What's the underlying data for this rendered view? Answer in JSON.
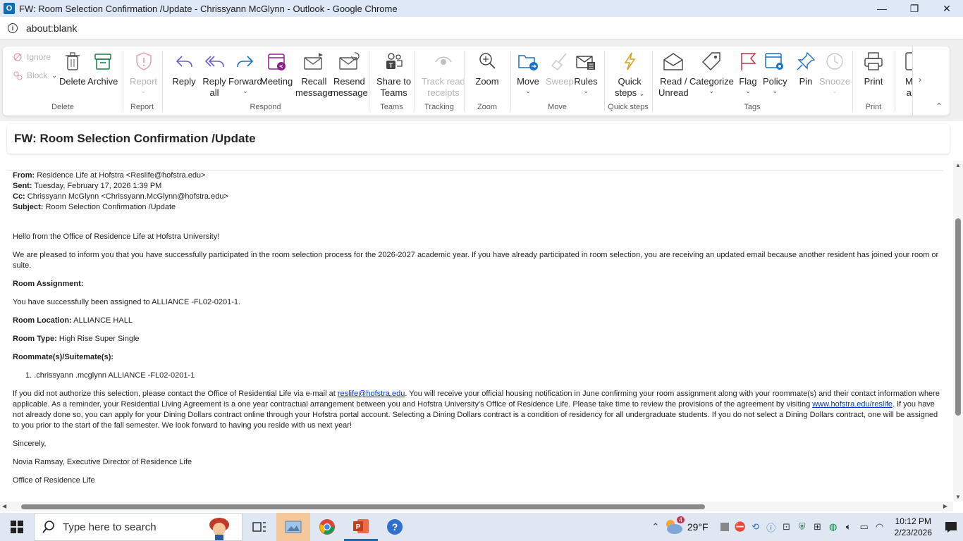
{
  "window": {
    "title": "FW: Room Selection Confirmation /Update - Chrissyann McGlynn - Outlook - Google Chrome",
    "app_icon_letter": "O",
    "url": "about:blank",
    "controls": {
      "minimize": "—",
      "restore": "❐",
      "close": "✕"
    }
  },
  "ribbon": {
    "delete_group": {
      "label": "Delete",
      "ignore": "Ignore",
      "block": "Block",
      "delete": "Delete",
      "archive": "Archive"
    },
    "report_group": {
      "label": "Report",
      "report": "Report"
    },
    "respond_group": {
      "label": "Respond",
      "reply": "Reply",
      "reply_all_1": "Reply",
      "reply_all_2": "all",
      "forward": "Forward",
      "meeting": "Meeting",
      "recall_1": "Recall",
      "recall_2": "message",
      "resend_1": "Resend",
      "resend_2": "message"
    },
    "teams_group": {
      "label": "Teams",
      "share_1": "Share to",
      "share_2": "Teams"
    },
    "tracking_group": {
      "label": "Tracking",
      "track_1": "Track read",
      "track_2": "receipts"
    },
    "zoom_group": {
      "label": "Zoom",
      "zoom": "Zoom"
    },
    "move_group": {
      "label": "Move",
      "move": "Move",
      "sweep": "Sweep",
      "rules": "Rules"
    },
    "quicksteps_group": {
      "label": "Quick steps",
      "quick_1": "Quick",
      "quick_2": "steps"
    },
    "tags_group": {
      "label": "Tags",
      "read_1": "Read /",
      "read_2": "Unread",
      "categorize": "Categorize",
      "flag": "Flag",
      "policy": "Policy",
      "pin": "Pin",
      "snooze": "Snooze"
    },
    "print_group": {
      "label": "Print",
      "print": "Print"
    },
    "more_1": "Mo",
    "more_2": "ap"
  },
  "subject": "FW: Room Selection Confirmation /Update",
  "email": {
    "from_label": "From:",
    "from": "Residence Life at Hofstra <Reslife@hofstra.edu>",
    "sent_label": "Sent:",
    "sent": "Tuesday, February 17, 2026 1:39 PM",
    "cc_label": "Cc:",
    "cc": "Chrissyann McGlynn <Chrissyann.McGlynn@hofstra.edu>",
    "subject_label": "Subject:",
    "subject": "Room Selection Confirmation /Update",
    "greeting": "Hello from the Office of Residence Life at Hofstra University!",
    "intro": "We are pleased to inform you that you have successfully participated in the room selection process for the 2026-2027 academic year. If you have already participated in room selection, you are receiving an updated email because another resident has joined your room or suite.",
    "assignment_heading": "Room Assignment:",
    "assignment_text": "You have successfully been assigned to ALLIANCE -FL02-0201-1.",
    "location_label": "Room Location:",
    "location": "ALLIANCE HALL",
    "type_label": "Room Type:",
    "type": "High Rise Super Single",
    "roommates_heading": "Roommate(s)/Suitemate(s):",
    "roommate_1_num": "1.",
    "roommate_1": ".chrissyann .mcglynn ALLIANCE -FL02-0201-1",
    "body_p1_a": "If you did not authorize this selection, please contact the Office of Residential Life via e-mail at ",
    "body_p1_link": "reslife@hofstra.edu",
    "body_p1_b": ". You will receive your official housing notification in June confirming your room assignment along with your roommate(s) and their contact information where applicable. As a reminder, your Residential Living Agreement is a one year contractual arrangement between you and Hofstra University's Office of Residence Life. Please take time to review the provisions of the agreement by visiting ",
    "body_p1_link2": "www.hofstra.edu/reslife",
    "body_p1_c": ". If you have not already done so, you can apply for your Dining Dollars contract online through your Hofstra portal account. Selecting a Dining Dollars contract is a condition of residency for all undergraduate students. If you do not select a Dining Dollars contract, one will be assigned to you prior to the start of the fall semester. We look forward to having you reside with us next year!",
    "closing": "Sincerely,",
    "signature": "Novia Ramsay, Executive Director of Residence Life",
    "office": "Office of Residence Life"
  },
  "taskbar": {
    "search_placeholder": "Type here to search",
    "weather_temp": "29°F",
    "weather_badge": "4",
    "time": "10:12 PM",
    "date": "2/23/2026"
  },
  "colors": {
    "accent": "#0f6cbd",
    "link": "#0033cc",
    "purple": "#8b1e8b",
    "red": "#c4314b"
  }
}
